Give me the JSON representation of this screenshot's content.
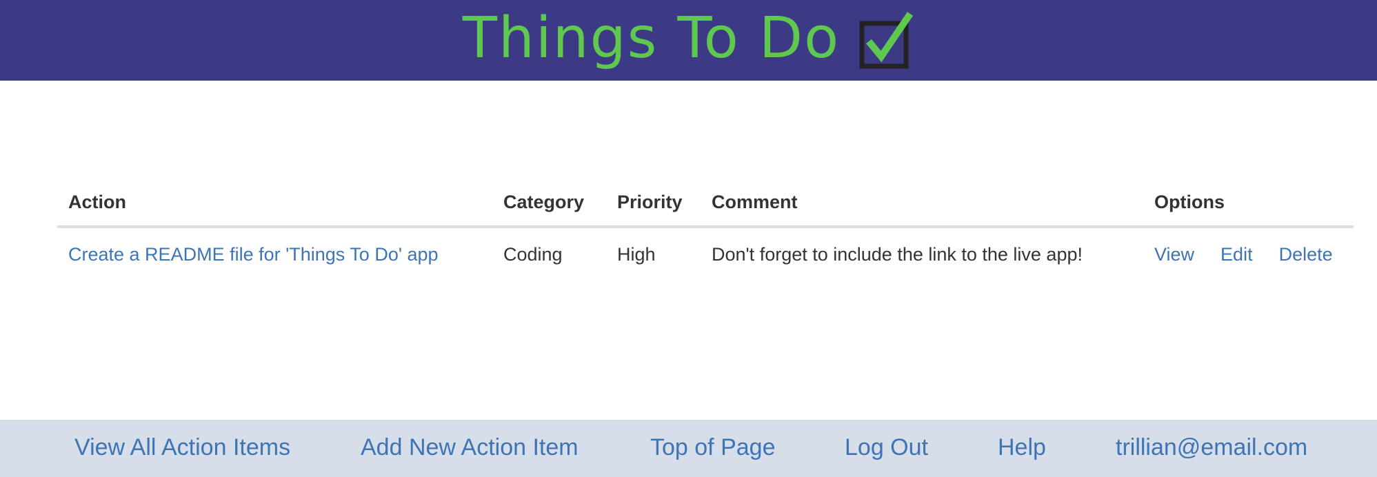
{
  "header": {
    "title": "Things To Do",
    "icon": "checkbox-checked-icon",
    "background": "#3d3a85",
    "title_color": "#5fc94f"
  },
  "table": {
    "columns": [
      "Action",
      "Category",
      "Priority",
      "Comment",
      "Options"
    ],
    "rows": [
      {
        "action": "Create a README file for 'Things To Do' app",
        "category": "Coding",
        "priority": "High",
        "comment": "Don't forget to include the link to the live app!",
        "options": [
          "View",
          "Edit",
          "Delete"
        ]
      }
    ]
  },
  "footer": {
    "links": [
      "View All Action Items",
      "Add New Action Item",
      "Top of Page",
      "Log Out",
      "Help",
      "trillian@email.com"
    ],
    "background": "#d6deea",
    "link_color": "#3e74b3"
  }
}
